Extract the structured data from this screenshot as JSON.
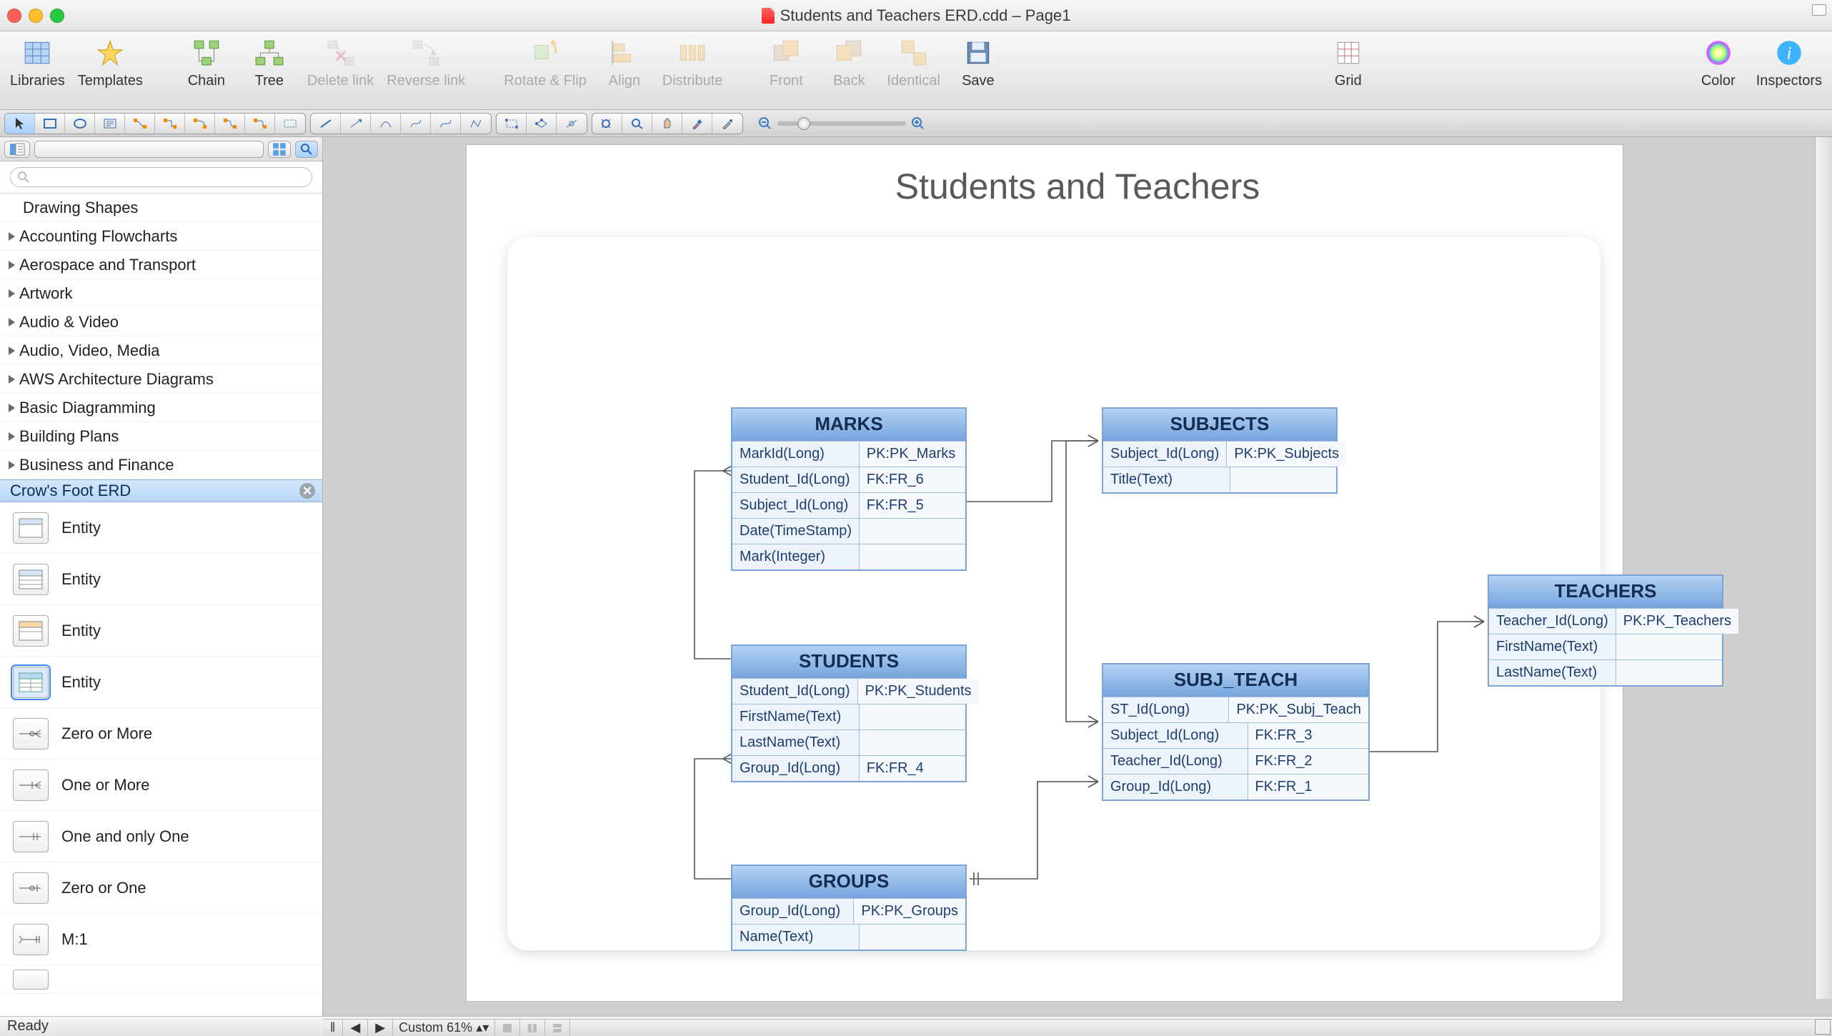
{
  "window": {
    "title": "Students and Teachers ERD.cdd – Page1"
  },
  "toolbar": {
    "libraries": "Libraries",
    "templates": "Templates",
    "chain": "Chain",
    "tree": "Tree",
    "delete_link": "Delete link",
    "reverse_link": "Reverse link",
    "rotate_flip": "Rotate & Flip",
    "align": "Align",
    "distribute": "Distribute",
    "front": "Front",
    "back": "Back",
    "identical": "Identical",
    "save": "Save",
    "grid": "Grid",
    "color": "Color",
    "inspectors": "Inspectors"
  },
  "sidebar": {
    "categories": [
      "Drawing Shapes",
      "Accounting Flowcharts",
      "Aerospace and Transport",
      "Artwork",
      "Audio & Video",
      "Audio, Video, Media",
      "AWS Architecture Diagrams",
      "Basic Diagramming",
      "Building Plans",
      "Business and Finance"
    ],
    "selected_library": "Crow's Foot ERD",
    "shapes": [
      "Entity",
      "Entity",
      "Entity",
      "Entity",
      "Zero or More",
      "One or More",
      "One and only One",
      "Zero or One",
      "M:1"
    ]
  },
  "canvas": {
    "title": "Students and Teachers",
    "entities": {
      "marks": {
        "name": "MARKS",
        "rows": [
          [
            "MarkId(Long)",
            "PK:PK_Marks"
          ],
          [
            "Student_Id(Long)",
            "FK:FR_6"
          ],
          [
            "Subject_Id(Long)",
            "FK:FR_5"
          ],
          [
            "Date(TimeStamp)",
            ""
          ],
          [
            "Mark(Integer)",
            ""
          ]
        ]
      },
      "subjects": {
        "name": "SUBJECTS",
        "rows": [
          [
            "Subject_Id(Long)",
            "PK:PK_Subjects"
          ],
          [
            "Title(Text)",
            ""
          ]
        ]
      },
      "students": {
        "name": "STUDENTS",
        "rows": [
          [
            "Student_Id(Long)",
            "PK:PK_Students"
          ],
          [
            "FirstName(Text)",
            ""
          ],
          [
            "LastName(Text)",
            ""
          ],
          [
            "Group_Id(Long)",
            "FK:FR_4"
          ]
        ]
      },
      "subj_teach": {
        "name": "SUBJ_TEACH",
        "rows": [
          [
            "ST_Id(Long)",
            "PK:PK_Subj_Teach"
          ],
          [
            "Subject_Id(Long)",
            "FK:FR_3"
          ],
          [
            "Teacher_Id(Long)",
            "FK:FR_2"
          ],
          [
            "Group_Id(Long)",
            "FK:FR_1"
          ]
        ]
      },
      "teachers": {
        "name": "TEACHERS",
        "rows": [
          [
            "Teacher_Id(Long)",
            "PK:PK_Teachers"
          ],
          [
            "FirstName(Text)",
            ""
          ],
          [
            "LastName(Text)",
            ""
          ]
        ]
      },
      "groups": {
        "name": "GROUPS",
        "rows": [
          [
            "Group_Id(Long)",
            "PK:PK_Groups"
          ],
          [
            "Name(Text)",
            ""
          ]
        ]
      }
    }
  },
  "footer": {
    "zoom": "Custom 61%",
    "status": "Ready"
  }
}
